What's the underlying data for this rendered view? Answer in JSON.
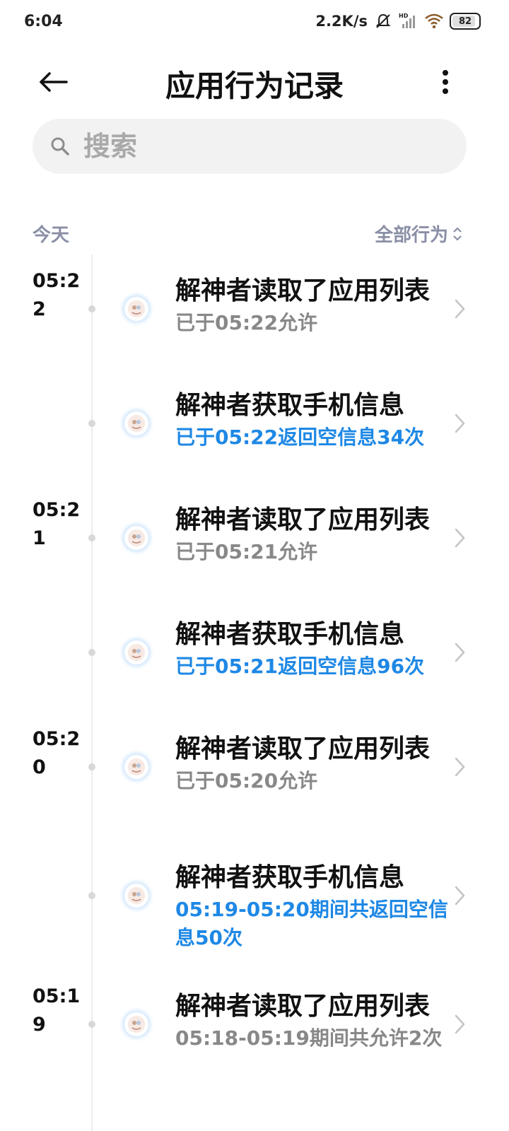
{
  "status_bar": {
    "time": "6:04",
    "net_speed": "2.2K/s",
    "battery": "82",
    "icons": [
      "mute-bell-icon",
      "hd-signal-icon",
      "wifi-icon",
      "battery-icon"
    ]
  },
  "app_bar": {
    "title": "应用行为记录",
    "icons": [
      "back-arrow-icon",
      "more-vert-icon"
    ]
  },
  "search": {
    "placeholder": "搜索"
  },
  "list": {
    "day_label": "今天",
    "filter_label": "全部行为",
    "entries": [
      {
        "time": "05:22",
        "title": "解神者读取了应用列表",
        "subtitle": "已于05:22允许",
        "subtitle_color": "gray"
      },
      {
        "time": "",
        "title": "解神者获取手机信息",
        "subtitle": "已于05:22返回空信息34次",
        "subtitle_color": "blue"
      },
      {
        "time": "05:21",
        "title": "解神者读取了应用列表",
        "subtitle": "已于05:21允许",
        "subtitle_color": "gray"
      },
      {
        "time": "",
        "title": "解神者获取手机信息",
        "subtitle": "已于05:21返回空信息96次",
        "subtitle_color": "blue"
      },
      {
        "time": "05:20",
        "title": "解神者读取了应用列表",
        "subtitle": "已于05:20允许",
        "subtitle_color": "gray"
      },
      {
        "time": "",
        "title": "解神者获取手机信息",
        "subtitle": "05:19-05:20期间共返回空信息50次",
        "subtitle_color": "blue"
      },
      {
        "time": "05:19",
        "title": "解神者读取了应用列表",
        "subtitle": "05:18-05:19期间共允许2次",
        "subtitle_color": "gray"
      }
    ]
  },
  "colors": {
    "accent_blue": "#1e88e5",
    "muted_label": "#8a8fa6",
    "gray_text": "#888888"
  }
}
